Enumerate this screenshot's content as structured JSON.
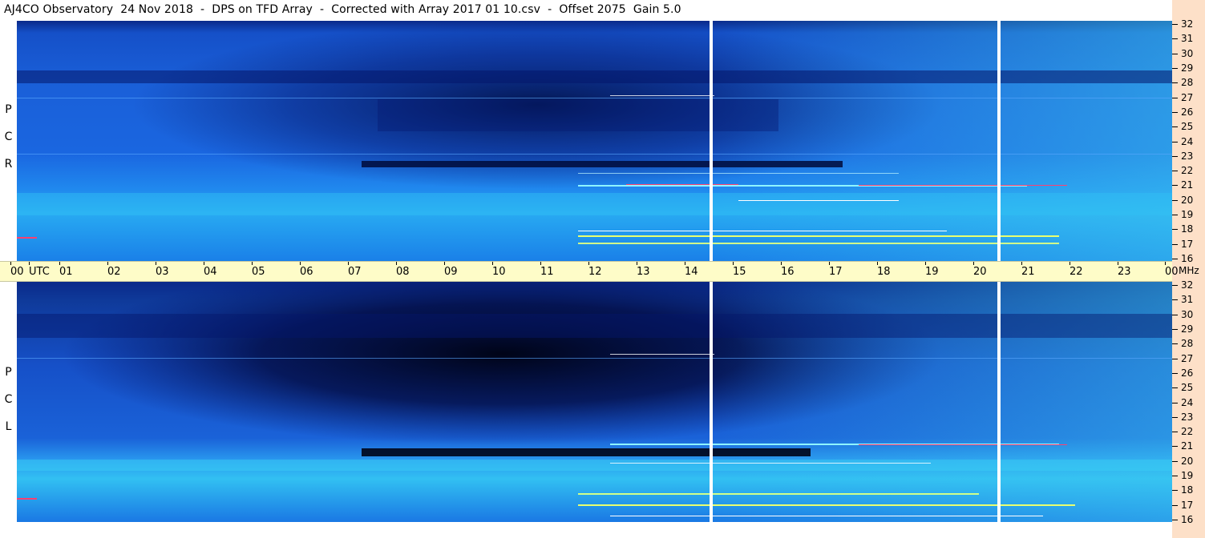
{
  "header": {
    "title": "AJ4CO Observatory  24 Nov 2018  -  DPS on TFD Array  -  Corrected with Array 2017 01 10.csv  -  Offset 2075  Gain 5.0"
  },
  "panels": [
    {
      "id": "rcp",
      "label_letters": [
        "R",
        "C",
        "P"
      ]
    },
    {
      "id": "lcp",
      "label_letters": [
        "L",
        "C",
        "P"
      ]
    }
  ],
  "time_axis": {
    "labels": [
      "00",
      "UTC",
      "01",
      "02",
      "03",
      "04",
      "05",
      "06",
      "07",
      "08",
      "09",
      "10",
      "11",
      "12",
      "13",
      "14",
      "15",
      "16",
      "17",
      "18",
      "19",
      "20",
      "21",
      "22",
      "23",
      "00"
    ]
  },
  "freq_axis": {
    "labels": [
      "32",
      "31",
      "30",
      "29",
      "28",
      "27",
      "26",
      "25",
      "24",
      "23",
      "22",
      "21",
      "20",
      "19",
      "18",
      "17",
      "16"
    ],
    "unit": "MHz"
  },
  "colors": {
    "background_blue": "#1c72e8",
    "dark_band": "#000a3a",
    "light_band": "#2ec4f0",
    "axis_bg": "#fefcc8",
    "right_strip": "#fde0c8"
  }
}
